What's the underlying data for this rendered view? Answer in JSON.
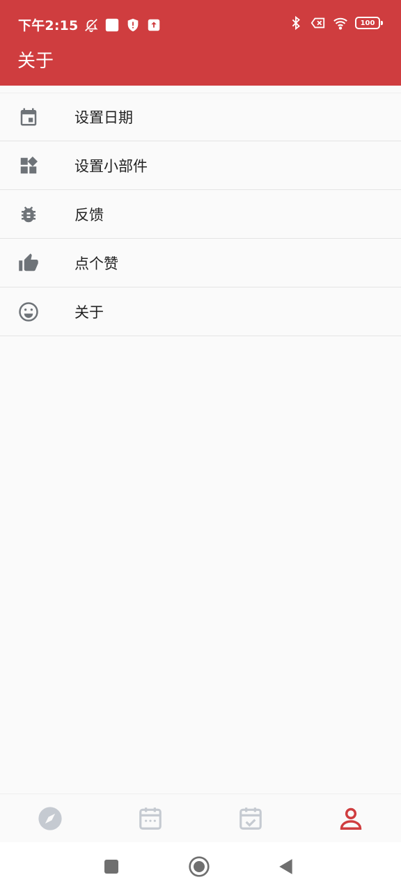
{
  "status_bar": {
    "time": "下午2:15",
    "battery": "100",
    "left_icons": [
      "mute-bell-icon",
      "app-square-icon",
      "shield-icon",
      "upload-icon"
    ],
    "right_icons": [
      "bluetooth-icon",
      "sim-x-icon",
      "wifi-icon",
      "battery-icon"
    ]
  },
  "toolbar": {
    "title": "关于"
  },
  "menu": {
    "items": [
      {
        "label": "设置日期",
        "icon": "calendar-icon"
      },
      {
        "label": "设置小部件",
        "icon": "widgets-icon"
      },
      {
        "label": "反馈",
        "icon": "bug-icon"
      },
      {
        "label": "点个赞",
        "icon": "thumb-up-icon"
      },
      {
        "label": "关于",
        "icon": "smile-icon"
      }
    ]
  },
  "bottom_nav": {
    "tabs": [
      {
        "icon": "compass-icon",
        "active": false
      },
      {
        "icon": "calendar-grid-icon",
        "active": false
      },
      {
        "icon": "calendar-check-icon",
        "active": false
      },
      {
        "icon": "person-icon",
        "active": true
      }
    ]
  },
  "system_nav": [
    "recent-apps-icon",
    "home-icon",
    "back-icon"
  ],
  "colors": {
    "primary": "#cf3d3f",
    "icon_gray": "#6e7378",
    "nav_inactive": "#c5cad1",
    "nav_active": "#cf3d3f",
    "background": "#fafafa"
  }
}
